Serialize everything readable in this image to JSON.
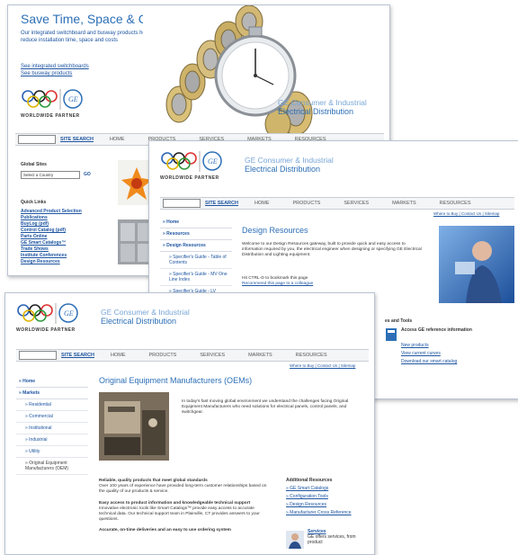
{
  "win_a": {
    "hero_title": "Save Time, Space & Cost",
    "hero_text": "Our integrated switchboard and busway products help reduce installation time, space and costs",
    "hero_links": [
      "See integrated switchboards",
      "See busway products"
    ],
    "partner": "WORLDWIDE PARTNER",
    "brand_line1": "GE Consumer & Industrial",
    "brand_line2": "Electrical Distribution",
    "nav": {
      "site_search": "SITE SEARCH",
      "items": [
        "HOME",
        "PRODUCTS",
        "SERVICES",
        "MARKETS",
        "RESOURCES"
      ]
    },
    "global_sites_label": "Global Sites",
    "country_select": "Select a Country",
    "go": "GO",
    "quick_links_label": "Quick Links",
    "quick_links": [
      "Advanced Product Selection",
      "Publications",
      "BuyLog (pdf)",
      "Control Catalog (pdf)",
      "Parts Online",
      "GE Smart Catalogs™",
      "Trade Shows",
      "Institute Conferences",
      "Design Resources"
    ]
  },
  "win_b": {
    "partner": "WORLDWIDE PARTNER",
    "brand_line1": "GE Consumer & Industrial",
    "brand_line2": "Electrical Distribution",
    "nav": {
      "site_search": "SITE SEARCH",
      "items": [
        "HOME",
        "PRODUCTS",
        "SERVICES",
        "MARKETS",
        "RESOURCES"
      ]
    },
    "util": "Where to Buy | Contact Us | Sitemap",
    "menu": [
      "Home",
      "Resources",
      "Design Resources"
    ],
    "submenu": [
      "Specifier's Guide - Table of Contents",
      "Specifier's Guide - MV One Line Index",
      "Specifier's Guide - LV"
    ],
    "title": "Design Resources",
    "intro": "Welcome to our Design Resources gateway, built to provide quick and easy access to information required by you, the electrical engineer when designing or specifying GE Electrical Distribution and Lighting equipment.",
    "bookmark": "Hit CTRL-D to bookmark this page",
    "recommend": "Recommend this page to a colleague",
    "tools_title": "es and Tools",
    "access_ref": "Access GE reference information",
    "tool_links": [
      "New products",
      "View current curves",
      "Download our smart catalog"
    ]
  },
  "win_c": {
    "partner": "WORLDWIDE PARTNER",
    "brand_line1": "GE Consumer & Industrial",
    "brand_line2": "Electrical Distribution",
    "nav": {
      "site_search": "SITE SEARCH",
      "items": [
        "HOME",
        "PRODUCTS",
        "SERVICES",
        "MARKETS",
        "RESOURCES"
      ]
    },
    "util": "Where to Buy | Contact Us | Sitemap",
    "menu": [
      "Home",
      "Markets"
    ],
    "submenu": [
      "Residential",
      "Commercial",
      "Institutional",
      "Industrial",
      "Utility",
      "Original Equipment Manufacturers (OEM)"
    ],
    "title": "Original Equipment Manufacturers (OEMs)",
    "intro": "In today's fast moving global environment we understand the challenges facing Original Equipment Manufacturers who need solutions for electrical panels, control panels, and switchgear.",
    "h1": "Reliable, quality products that meet global standards",
    "p1": "Over 100 years of experience have provided long-term customer relationships based on the quality of our products & service.",
    "h2": "Easy access to product information and knowledgeable technical support",
    "p2": "Innovative electronic tools like Smart Catalogs™ provide easy access to accurate technical data. Our technical support team in Plainville, CT provides answers to your questions.",
    "h3": "Accurate, on-time deliveries and an easy to use ordering system",
    "add_res_title": "Additional Resources",
    "add_res": [
      "GE Smart Catalogs",
      "Configuration Tools",
      "Design Resources",
      "Manufacturer Cross Reference"
    ],
    "services_title": "Services",
    "services_text": "GE offers services, from product"
  }
}
